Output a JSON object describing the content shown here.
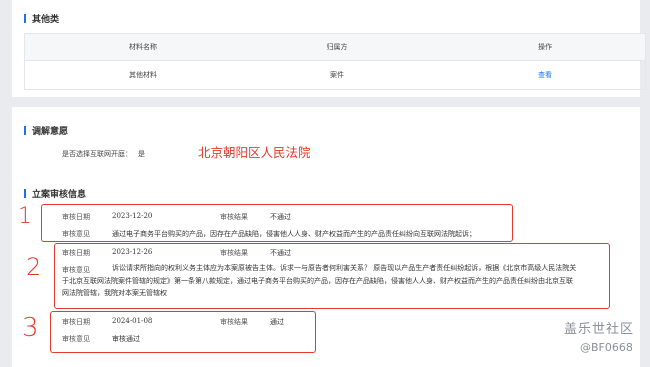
{
  "other": {
    "title": "其他类",
    "headers": [
      "材料名称",
      "归属方",
      "操作"
    ],
    "row": {
      "name": "其他材料",
      "owner": "案件",
      "action": "查看"
    }
  },
  "mediation": {
    "title": "调解意愿",
    "question": "是否选择互联网开庭：",
    "answer": "是"
  },
  "court_annotation": "北京朝阳区人民法院",
  "review": {
    "title": "立案审核信息",
    "date_label": "审核日期",
    "result_label": "审核结果",
    "opinion_label": "审核意见",
    "entries": [
      {
        "date": "2023-12-20",
        "result": "不通过",
        "opinion": "通过电子商务平台购买的产品，因存在产品缺陷，侵害他人人身、财产权益而产生的产品责任纠纷向互联网法院起诉；"
      },
      {
        "date": "2023-12-26",
        "result": "不通过",
        "opinion": "诉讼请求所指向的权利义务主体应为本案原被告主体。诉求一与原告者何利害关系？ 原告现以产品生产者责任纠纷起诉，根据《北京市高级人民法院关于北京互联网法院案件管辖的规定》第一条第八款规定，通过电子商务平台购买的产品，因存在产品缺陷，侵害他人人身、财产权益而产生的产品责任纠纷由北京互联网法院管辖，我院对本案无管辖权"
      },
      {
        "date": "2024-01-08",
        "result": "通过",
        "opinion": "审核通过"
      }
    ]
  },
  "annotations": [
    "1",
    "2",
    "3"
  ],
  "watermark": {
    "line1": "盖乐世社区",
    "line2": "@BF0668"
  },
  "colors": {
    "accent": "#1a73e8",
    "annotation": "#e33b2f",
    "background": "#e9ebee"
  }
}
